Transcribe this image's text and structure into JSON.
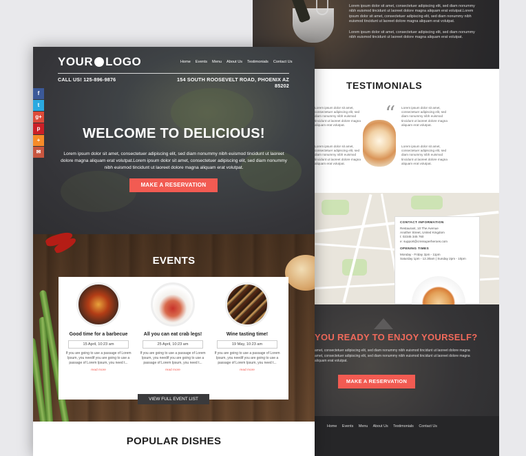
{
  "back": {
    "top_para_1": "Lorem ipsum dolor sit amet, consectetuer adipiscing elit, sed diam nonummy nibh euismod tincidunt ut laoreet dolore magna aliquam erat volutpat.Lorem ipsum dolor sit amet, consectetuer adipiscing elit, sed diam nonummy nibh euismod tincidunt ut laoreet dolore magna aliquam erat volutpat.",
    "top_para_2": "Lorem ipsum dolor sit amet, consectetuer adipiscing elit, sed diam nonummy nibh euismod tincidunt ut laoreet dolore magna aliquam erat volutpat.",
    "testimonials_title": "TESTIMONIALS",
    "testimonial_left": "Lorem ipsum dolor sit amet, consectetuer adipiscing elit, sed diam nonummy nibh euismod tincidunt ut laoreet dolore magna aliquam erat volutpat.",
    "testimonial_left_2": "Lorem ipsum dolor sit amet, consectetuer adipiscing elit, sed diam nonummy nibh euismod tincidunt ut laoreet dolore magna aliquam erat volutpat.",
    "testimonial_right": "Lorem ipsum dolor sit amet, consectetuer adipiscing elit, sed diam nonummy nibh euismod tincidunt ut laoreet dolore magna aliquam erat volutpat.",
    "testimonial_right_2": "Lorem ipsum dolor sit amet, consectetuer adipiscing elit, sed diam nonummy nibh euismod tincidunt ut laoreet dolore magna aliquam erat volutpat.",
    "contact": {
      "title": "CONTACT INFORMATION",
      "address_1": "Restaurant, 10 The Avenue",
      "address_2": "Another Street, United Kingdom",
      "phone": "t: 02345 345 760",
      "email": "e: support@cmssuperheroes.com",
      "hours_title": "OPENING TIMES",
      "hours_1": "Monday - Friday 2pm - 11pm",
      "hours_2": "Saturday 1pm - 12.30am | Sunday 2pm - 10pm"
    },
    "cta_title": "YOU READY TO ENJOY YOURSELF?",
    "cta_para": "amet, consectetuer adipiscing elit, sed diam nonummy nibh euismod tincidunt ut laoreet dolore magna amet, consectetuer adipiscing elit, sed diam nonummy nibh euismod tincidunt ut laoreet dolore magna aliquam erat volutpat.",
    "cta_button": "MAKE A RESERVATION",
    "footer_nav": [
      "Home",
      "Events",
      "Menu",
      "About Us",
      "Testimonials",
      "Contact Us"
    ]
  },
  "front": {
    "logo_left": "YOUR",
    "logo_right": "LOGO",
    "nav": [
      "Home",
      "Events",
      "Menu",
      "About Us",
      "Testimonials",
      "Contact Us"
    ],
    "phone": "CALL US! 125-896-9876",
    "address": "154 SOUTH ROOSEVELT ROAD, PHOENIX AZ 85202",
    "social": [
      "f",
      "t",
      "g+",
      "p",
      "+",
      "✉"
    ],
    "hero_title": "WELCOME TO DELICIOUS!",
    "hero_para": "Lorem ipsum dolor sit amet, consectetuer adipiscing elit, sed diam nonummy nibh euismod tincidunt ut laoreet dolore magna aliquam erat volutpat.Lorem ipsum dolor sit amet, consectetuer adipiscing elit, sed diam nonummy nibh euismod tincidunt ut laoreet dolore magna aliquam erat volutpat.",
    "hero_button": "MAKE A RESERVATION",
    "events_title": "EVENTS",
    "events": [
      {
        "title": "Good time for a barbecue",
        "date": "15 April, 10:23 am",
        "desc": "If you are going to use a passage of Lorem Ipsum, you needif you are going to use a passage of Lorem Ipsum, you need t...",
        "more": "read more"
      },
      {
        "title": "All you can eat crab legs!",
        "date": "25 April, 10:23 am",
        "desc": "If you are going to use a passage of Lorem Ipsum, you needif you are going to use a passage of Lorem Ipsum, you need t...",
        "more": "read more"
      },
      {
        "title": "Wine tasting time!",
        "date": "19 May, 10:23 am",
        "desc": "If you are going to use a passage of Lorem Ipsum, you needif you are going to use a passage of Lorem Ipsum, you need t...",
        "more": "read more"
      }
    ],
    "view_all": "VIEW FULL EVENT LIST",
    "popular_title": "POPULAR DISHES"
  },
  "colors": {
    "accent": "#f25b52",
    "dark": "#353539",
    "facebook": "#3b5998",
    "twitter": "#2aa9e0",
    "google": "#dd4b39",
    "pinterest": "#cb2027",
    "share": "#f68b28",
    "email": "#c8563f"
  }
}
